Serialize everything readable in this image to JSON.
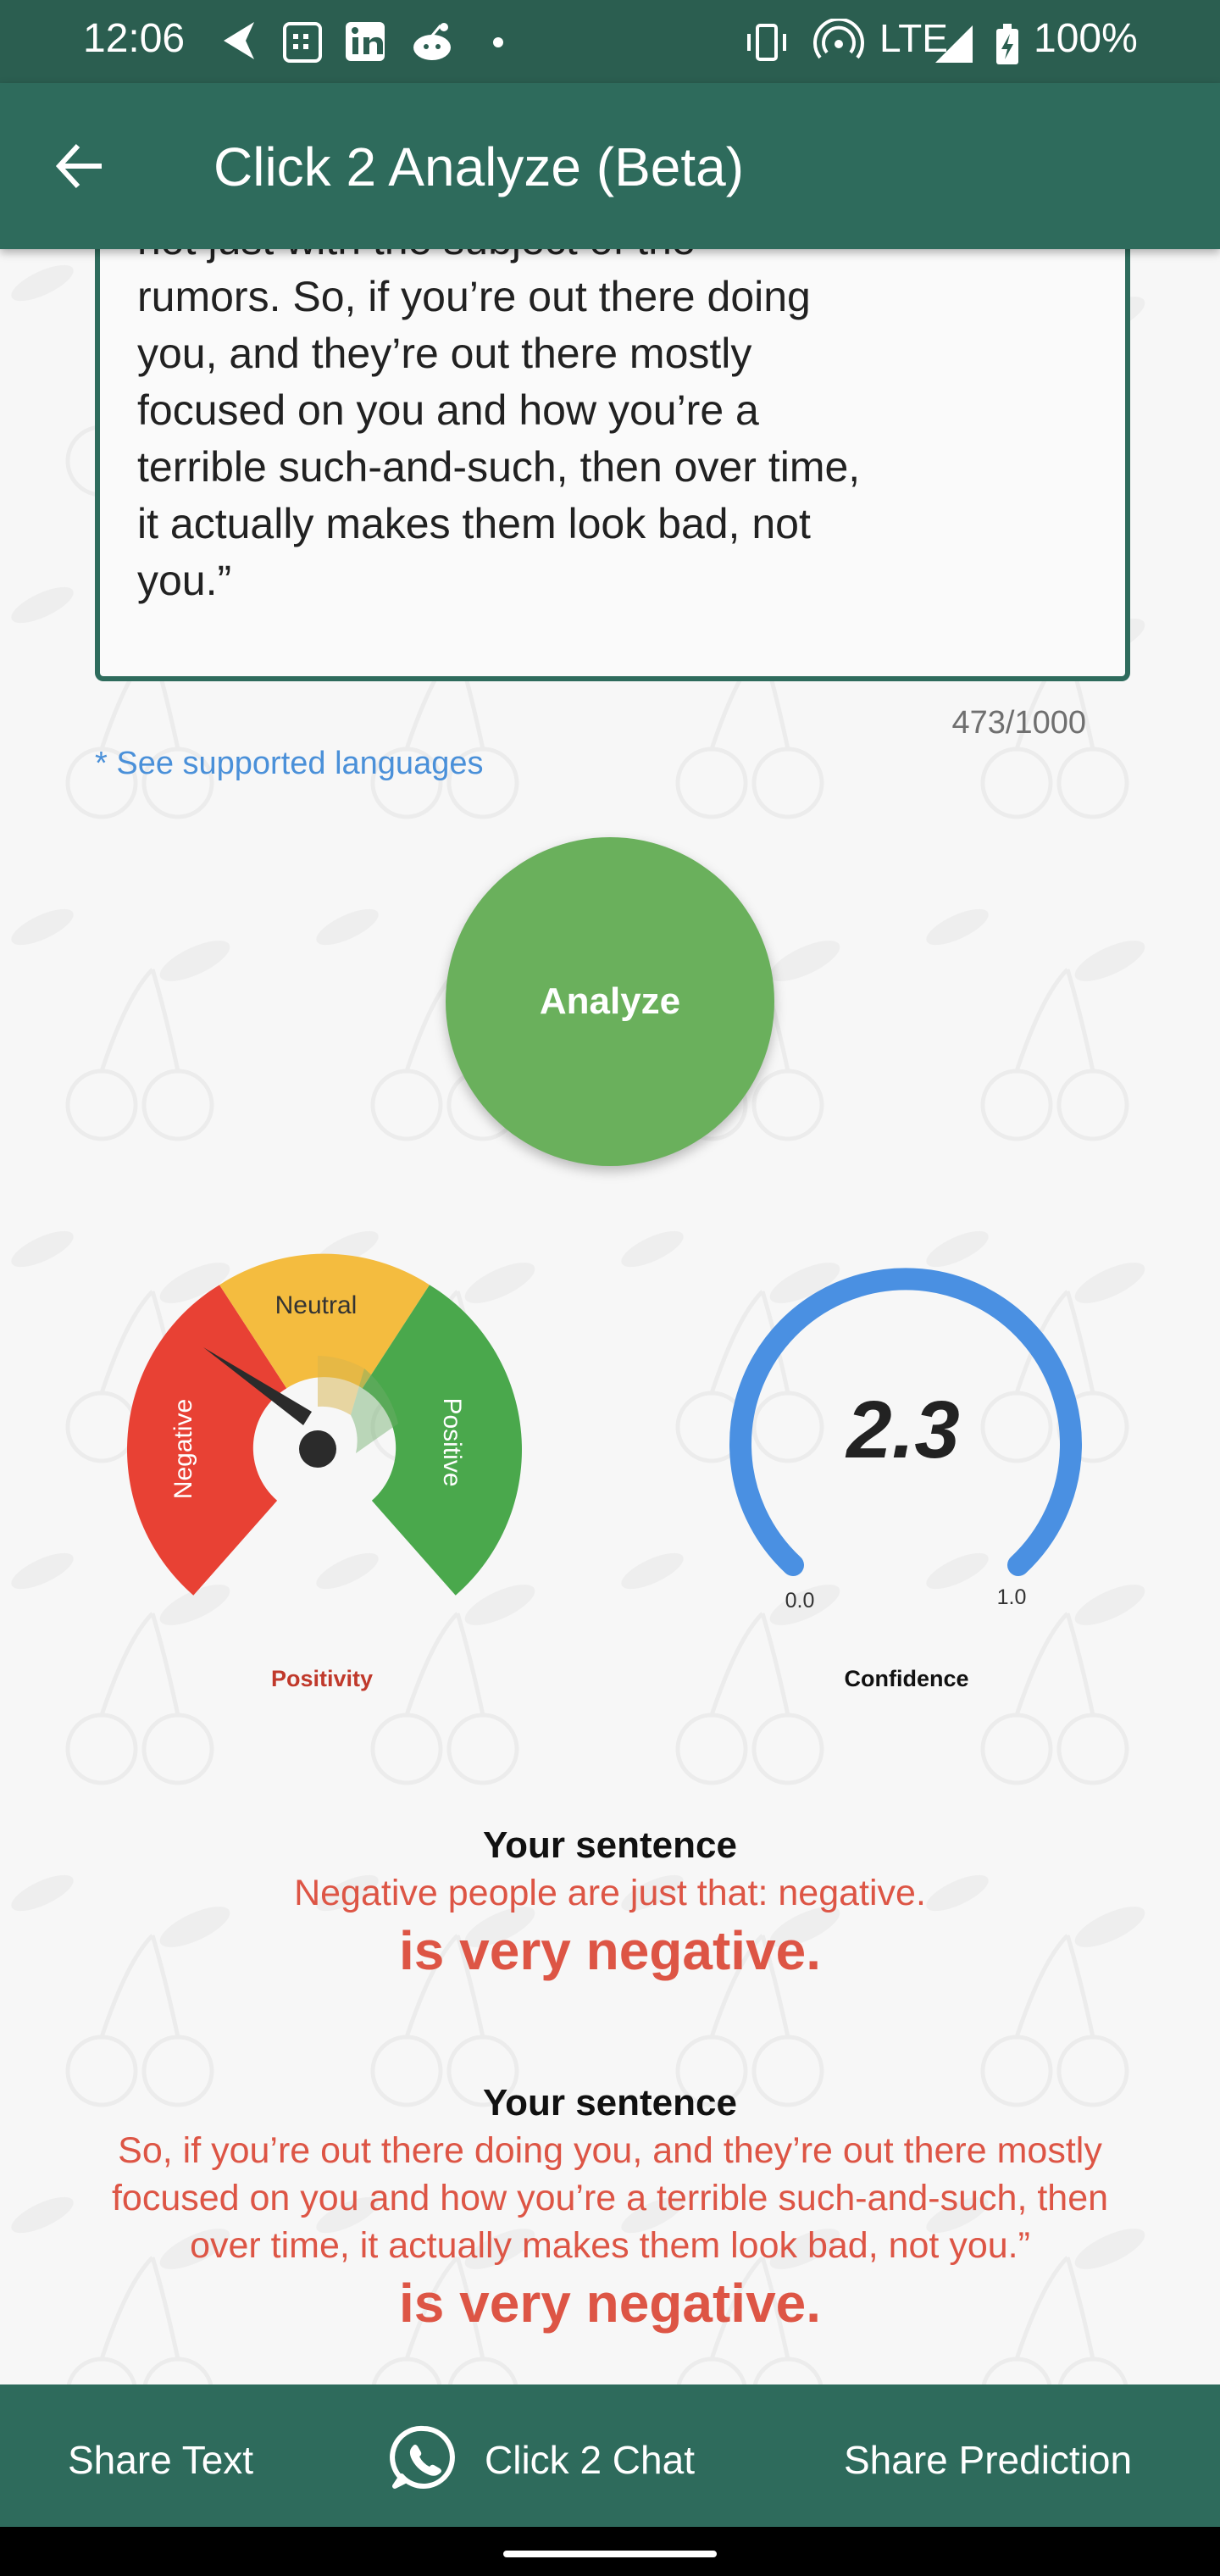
{
  "status_bar": {
    "time": "12:06",
    "network": "LTE",
    "battery": "100%",
    "left_icons": [
      "navigation-arrow-icon",
      "calendar-app-icon",
      "linkedin-icon",
      "reddit-icon",
      "more-dot-icon"
    ],
    "right_icons": [
      "vibrate-icon",
      "hotspot-icon",
      "signal-icon",
      "battery-icon"
    ]
  },
  "app_bar": {
    "title": "Click 2 Analyze (Beta)",
    "back_icon": "arrow-left-icon"
  },
  "input": {
    "lines": [
      "not just with the subject of the",
      "rumors. So, if you’re out there doing",
      "you, and they’re out there mostly",
      "focused on you and how you’re a",
      "terrible such-and-such, then over time,",
      "it actually makes them look bad, not",
      "you.”"
    ],
    "counter": "473/1000"
  },
  "links": {
    "supported_languages": "* See supported languages"
  },
  "analyze_button": {
    "label": "Analyze"
  },
  "positivity_gauge": {
    "segments": [
      "Negative",
      "Neutral",
      "Positive"
    ],
    "caption": "Positivity",
    "colors": {
      "negative": "#e84134",
      "neutral": "#f4bc3f",
      "positive": "#4aa84c",
      "caption": "#c0392b"
    }
  },
  "confidence_gauge": {
    "value": "2.3",
    "min_label": "0.0",
    "max_label": "1.0",
    "caption": "Confidence",
    "color": "#4a90e2"
  },
  "results": [
    {
      "heading": "Your sentence",
      "sentence_lines": [
        "Negative people are just that: negative."
      ],
      "verdict": "is very negative."
    },
    {
      "heading": "Your sentence",
      "sentence_lines": [
        "So, if you’re out there doing you, and they’re out there mostly",
        "focused on you and how you’re a terrible such-and-such, then",
        "over time, it actually makes them look bad, not you.”"
      ],
      "verdict": "is very negative."
    }
  ],
  "bottom_bar": {
    "share_text": "Share Text",
    "click_2_chat": "Click 2 Chat",
    "share_prediction": "Share Prediction",
    "chat_icon": "whatsapp-icon"
  }
}
